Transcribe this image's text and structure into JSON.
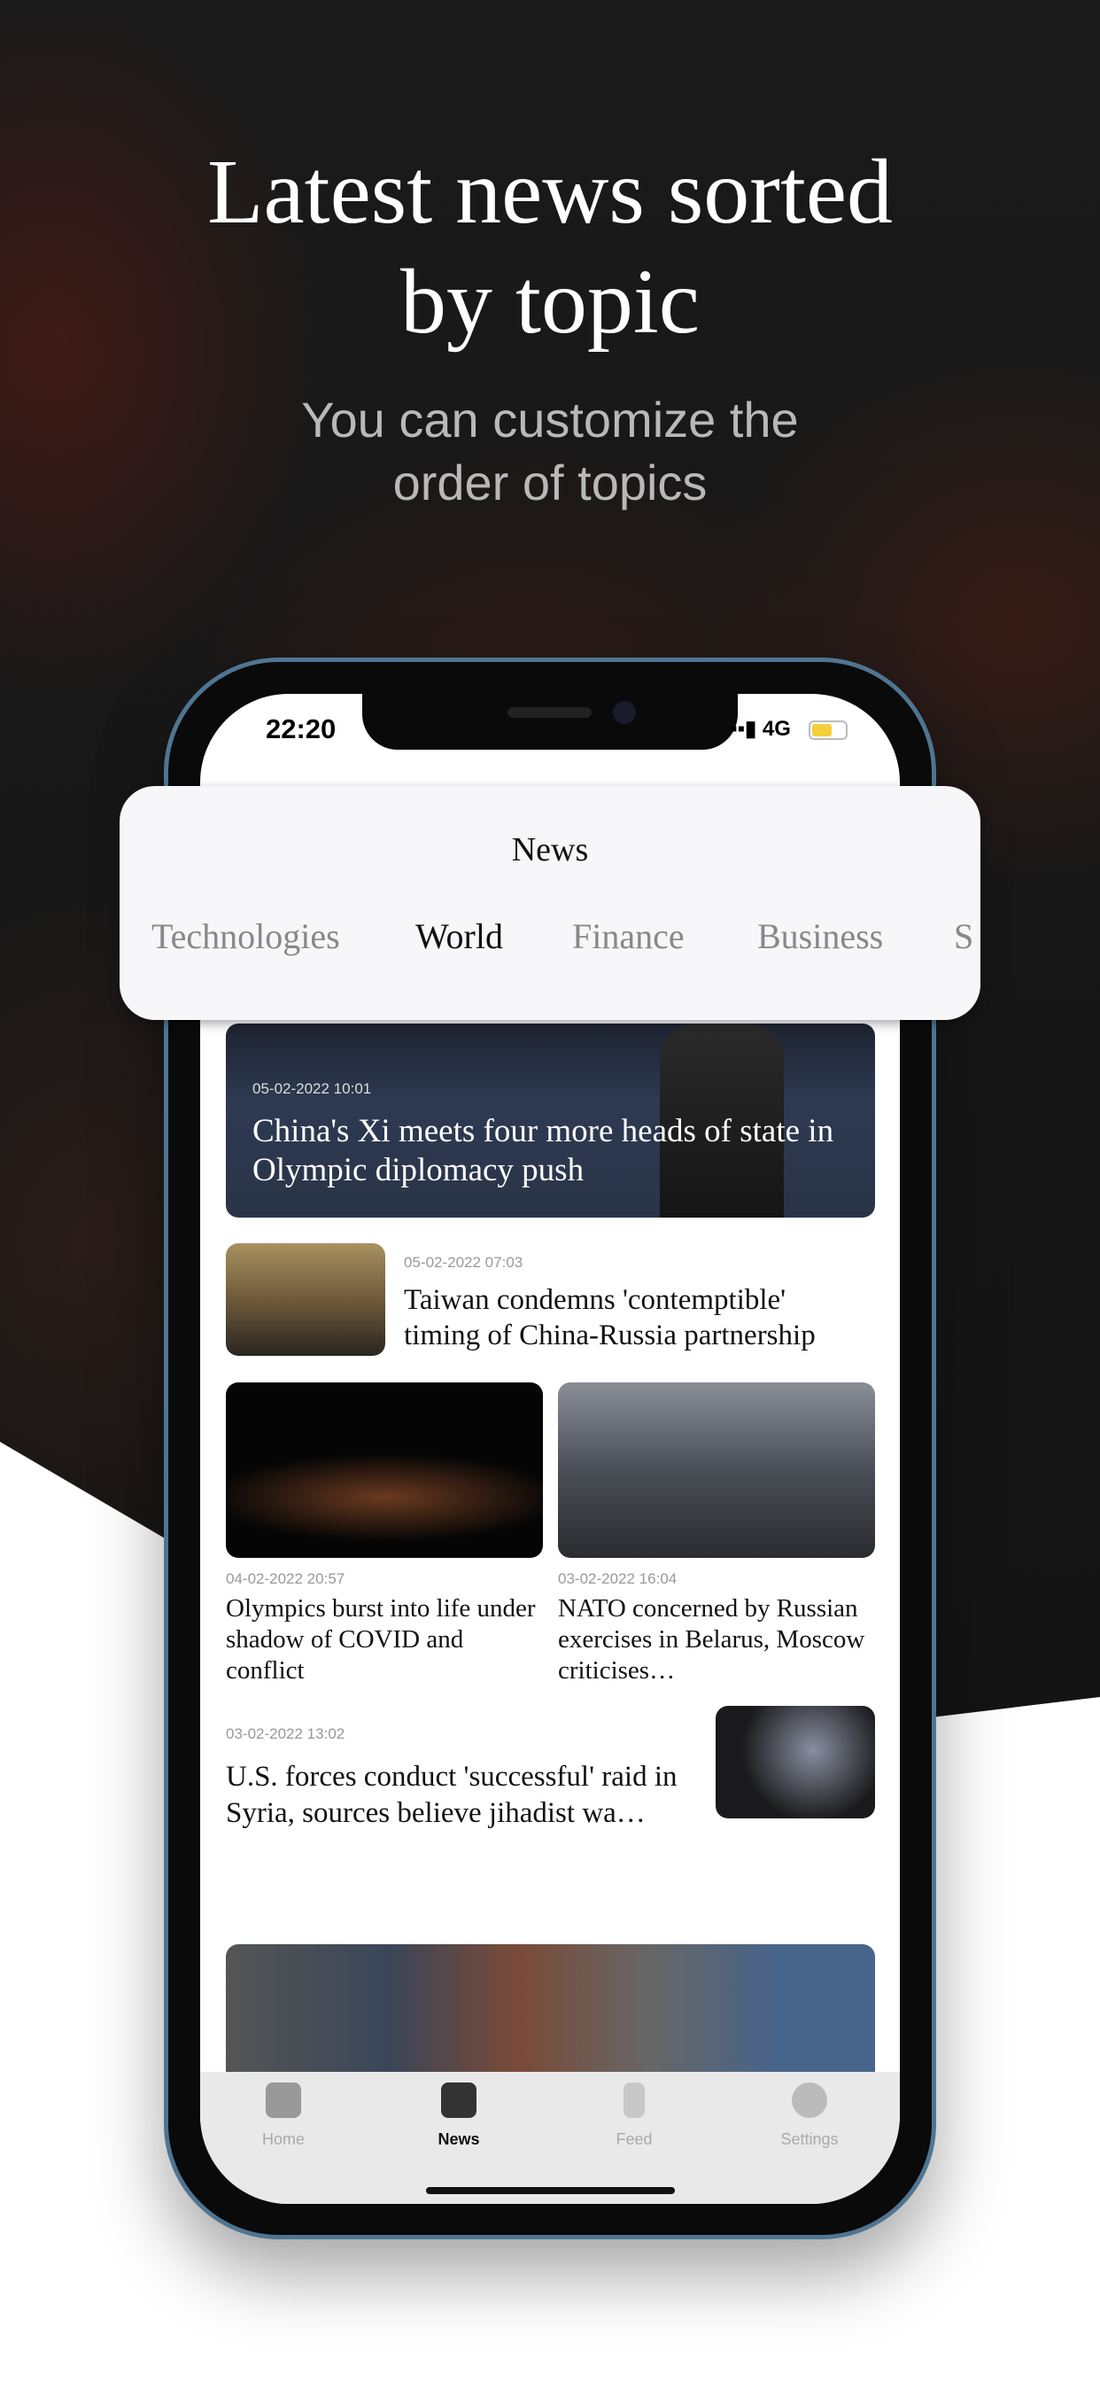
{
  "promo": {
    "headline": "Latest news sorted\nby topic",
    "subtitle": "You can customize the\norder of topics"
  },
  "status": {
    "time": "22:20",
    "network": "4G",
    "battery_color": "#f3cf3b"
  },
  "header": {
    "title": "News",
    "tabs": [
      "Technologies",
      "World",
      "Finance",
      "Business",
      "S"
    ],
    "active_tab": "World"
  },
  "articles": [
    {
      "date": "05-02-2022 10:01",
      "title": "China's Xi meets four more heads of state in Olympic diplomacy push"
    },
    {
      "date": "05-02-2022 07:03",
      "title": "Taiwan condemns 'contemptible' timing of China-Russia partnership"
    },
    {
      "date": "04-02-2022 20:57",
      "title": "Olympics burst into life under shadow of COVID and conflict"
    },
    {
      "date": "03-02-2022 16:04",
      "title": "NATO concerned by Russian exercises in Belarus, Moscow criticises…"
    },
    {
      "date": "03-02-2022 13:02",
      "title": "U.S. forces conduct 'successful' raid in Syria, sources believe jihadist wa…"
    }
  ],
  "tabbar": {
    "items": [
      {
        "label": "Home",
        "icon": "home-icon"
      },
      {
        "label": "News",
        "icon": "news-icon"
      },
      {
        "label": "Feed",
        "icon": "feed-icon"
      },
      {
        "label": "Settings",
        "icon": "gear-icon"
      }
    ],
    "active": "News"
  }
}
